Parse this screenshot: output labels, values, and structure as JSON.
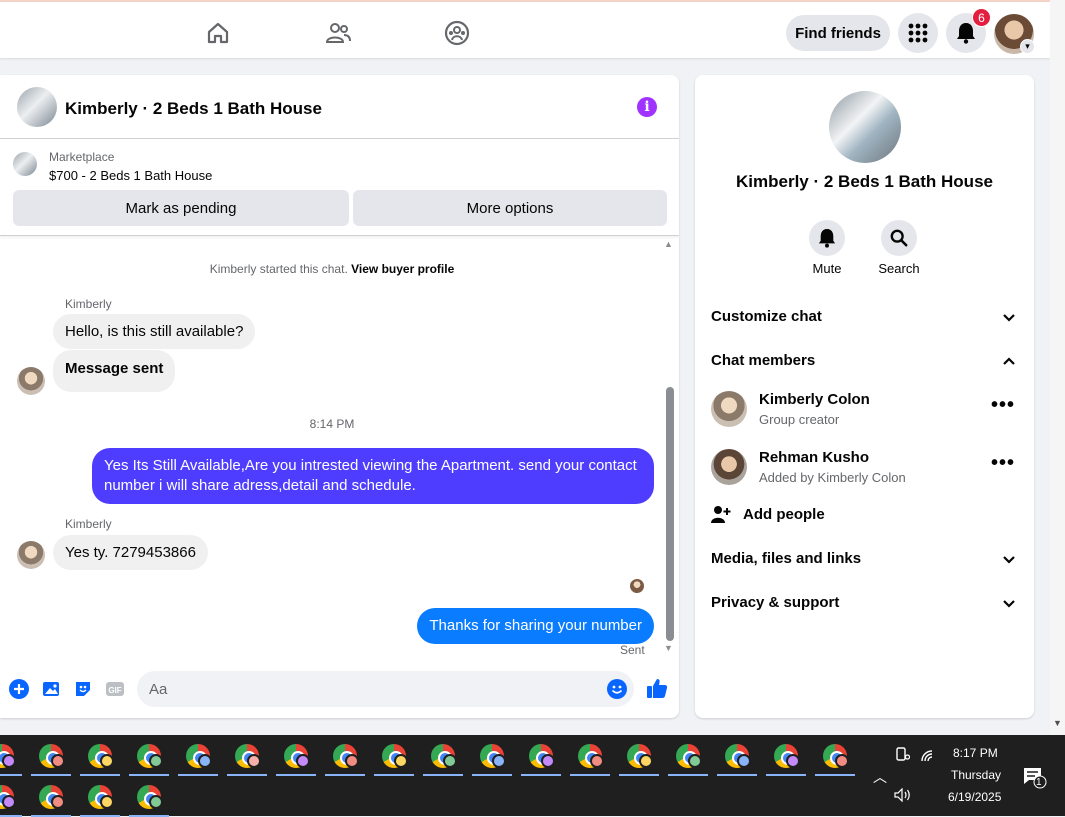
{
  "topbar": {
    "find_friends": "Find friends",
    "notification_count": "6"
  },
  "conversation": {
    "title": "Kimberly · 2 Beds 1 Bath House",
    "marketplace_label": "Marketplace",
    "listing": "$700 - 2 Beds 1 Bath House",
    "mark_pending": "Mark as pending",
    "more_options": "More options",
    "started_text": "Kimberly started this chat.",
    "view_profile": "View buyer profile",
    "messages": [
      {
        "sender": "Kimberly",
        "text": "Hello, is this still available?"
      },
      {
        "text": "Message sent"
      },
      {
        "timestamp": "8:14 PM"
      },
      {
        "text": "Yes Its Still Available,Are you intrested viewing the Apartment. send your contact number i will share adress,detail and schedule."
      },
      {
        "sender": "Kimberly",
        "text": "Yes ty. 7279453866"
      },
      {
        "text": "Thanks for sharing your number"
      }
    ],
    "sent_status": "Sent",
    "input_placeholder": "Aa"
  },
  "sidebar": {
    "title": "Kimberly · 2 Beds 1 Bath House",
    "mute": "Mute",
    "search": "Search",
    "customize_chat": "Customize chat",
    "chat_members": "Chat members",
    "members": [
      {
        "name": "Kimberly Colon",
        "role": "Group creator"
      },
      {
        "name": "Rehman Kusho",
        "role": "Added by Kimberly Colon"
      }
    ],
    "add_people": "Add people",
    "media": "Media, files and links",
    "privacy": "Privacy & support"
  },
  "taskbar": {
    "time": "8:17 PM",
    "day": "Thursday",
    "date": "6/19/2025",
    "notification_count": "1"
  },
  "colors": {
    "outgoing_bubble": "#4f3dff",
    "thanks_bubble": "#0a7cff",
    "accent": "#0866ff",
    "badge": "#e41e3f"
  }
}
